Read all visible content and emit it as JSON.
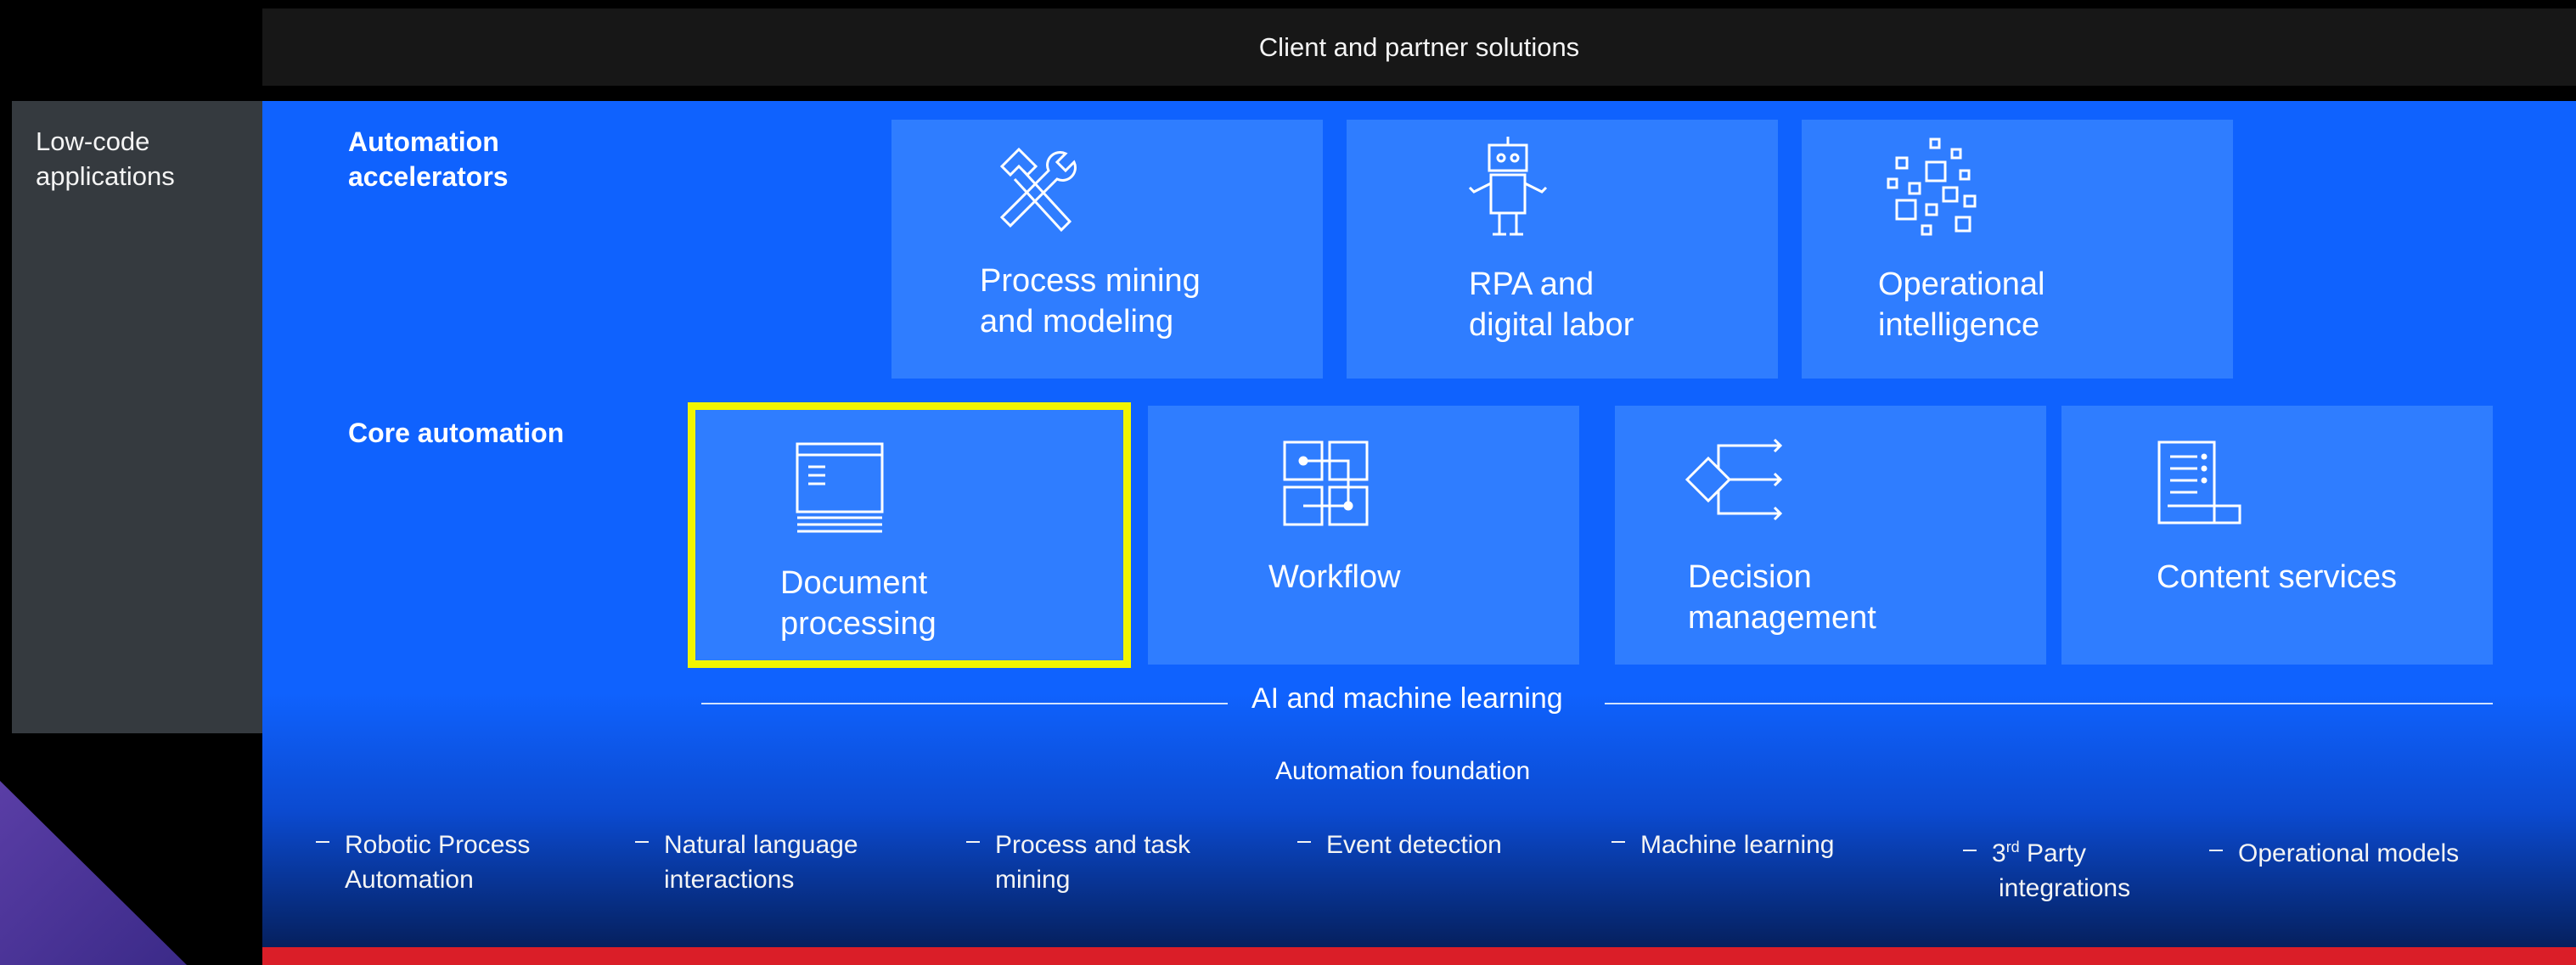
{
  "header": {
    "title": "Client and partner solutions"
  },
  "sidebar": {
    "label": "Low-code applications"
  },
  "sections": {
    "accelerators_label": "Automation accelerators",
    "core_label": "Core automation"
  },
  "accelerators": [
    {
      "label_line1": "Process mining",
      "label_line2": "and modeling",
      "icon": "hammer-wrench-icon"
    },
    {
      "label_line1": "RPA and",
      "label_line2": "digital labor",
      "icon": "robot-icon"
    },
    {
      "label_line1": "Operational",
      "label_line2": "intelligence",
      "icon": "data-blocks-icon"
    }
  ],
  "core": [
    {
      "label_line1": "Document",
      "label_line2": "processing",
      "icon": "document-scan-icon",
      "highlighted": true
    },
    {
      "label_line1": "Workflow",
      "label_line2": "",
      "icon": "workflow-icon",
      "highlighted": false
    },
    {
      "label_line1": "Decision",
      "label_line2": "management",
      "icon": "decision-icon",
      "highlighted": false
    },
    {
      "label_line1": "Content services",
      "label_line2": "",
      "icon": "content-document-icon",
      "highlighted": false
    }
  ],
  "ai_label": "AI and machine learning",
  "foundation": {
    "title": "Automation foundation",
    "items": [
      {
        "line1": "Robotic Process",
        "line2": "Automation"
      },
      {
        "line1": "Natural language",
        "line2": "interactions"
      },
      {
        "line1": "Process and task",
        "line2": "mining"
      },
      {
        "line1": "Event detection",
        "line2": ""
      },
      {
        "line1": "Machine learning",
        "line2": ""
      },
      {
        "prefix": "3",
        "sup": "rd",
        "line1_rest": " Party",
        "line2": "integrations"
      },
      {
        "line1": "Operational models",
        "line2": ""
      }
    ]
  },
  "colors": {
    "panel_blue": "#0f62fe",
    "tile_blue": "#2f7dff",
    "highlight": "#f1f500",
    "footer_red": "#da1e28",
    "header_bg": "#171717",
    "sidebar_bg": "#353a3f"
  }
}
